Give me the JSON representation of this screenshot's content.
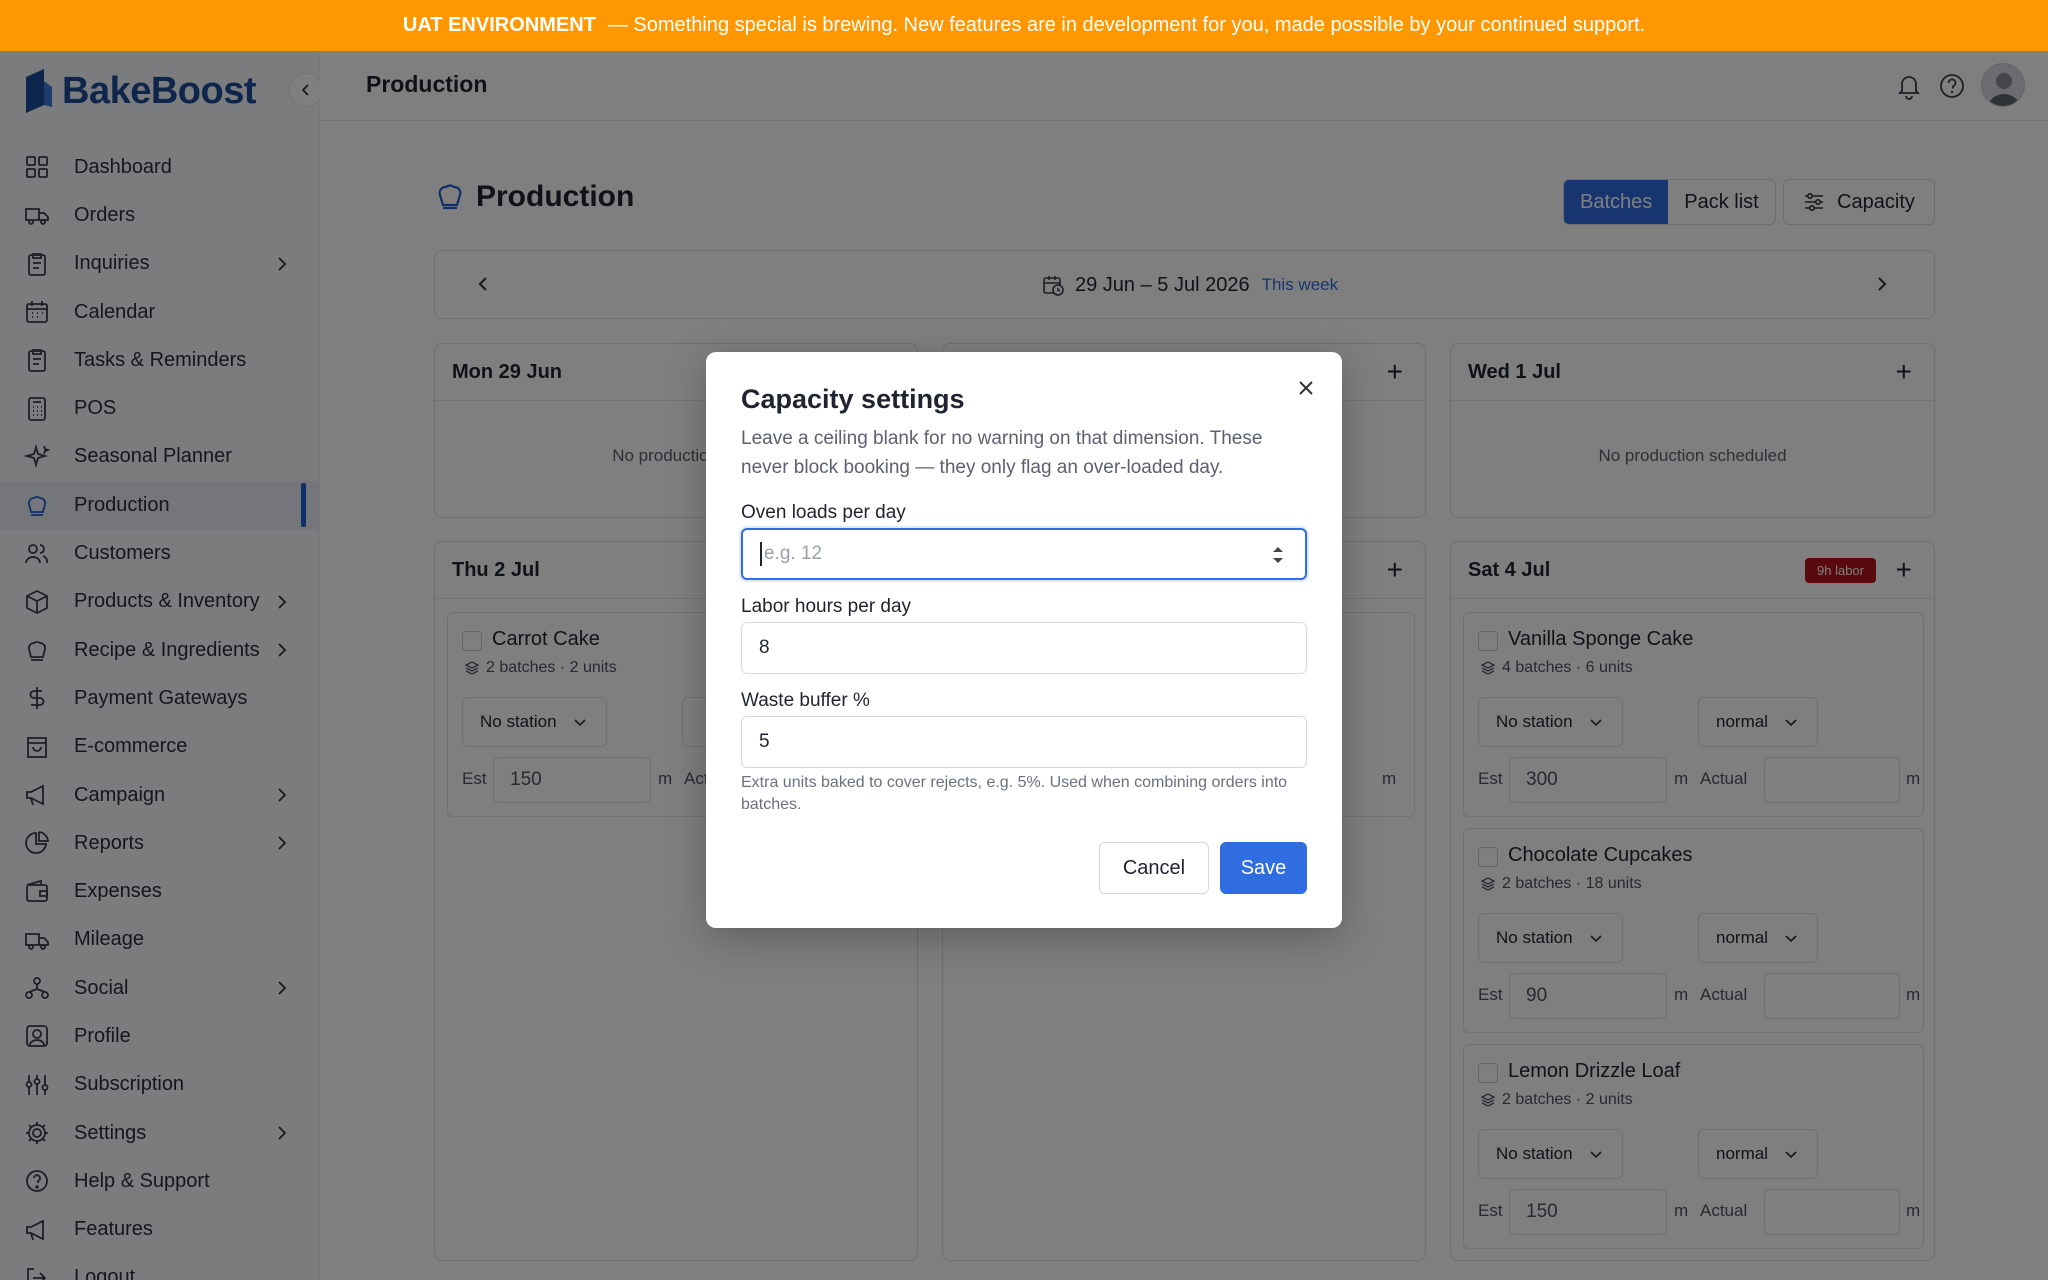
{
  "banner": {
    "env": "UAT ENVIRONMENT",
    "message": "— Something special is brewing. New features are in development for you, made possible by your continued support."
  },
  "app": {
    "name": "BakeBoost"
  },
  "sidebar": {
    "items": [
      {
        "label": "Dashboard",
        "icon": "grid-icon"
      },
      {
        "label": "Orders",
        "icon": "truck-icon"
      },
      {
        "label": "Inquiries",
        "icon": "clipboard-icon",
        "chevron": true
      },
      {
        "label": "Calendar",
        "icon": "calendar-icon"
      },
      {
        "label": "Tasks & Reminders",
        "icon": "clipboard-icon"
      },
      {
        "label": "POS",
        "icon": "calculator-icon"
      },
      {
        "label": "Seasonal Planner",
        "icon": "sparkle-icon"
      },
      {
        "label": "Production",
        "icon": "chef-hat-icon",
        "active": true
      },
      {
        "label": "Customers",
        "icon": "users-icon"
      },
      {
        "label": "Products & Inventory",
        "icon": "box-icon",
        "chevron": true
      },
      {
        "label": "Recipe & Ingredients",
        "icon": "chef-hat-icon",
        "chevron": true
      },
      {
        "label": "Payment Gateways",
        "icon": "dollar-icon"
      },
      {
        "label": "E-commerce",
        "icon": "shopping-bag-icon"
      },
      {
        "label": "Campaign",
        "icon": "megaphone-icon",
        "chevron": true
      },
      {
        "label": "Reports",
        "icon": "pie-chart-icon",
        "chevron": true
      },
      {
        "label": "Expenses",
        "icon": "wallet-icon"
      },
      {
        "label": "Mileage",
        "icon": "truck-icon"
      },
      {
        "label": "Social",
        "icon": "network-icon",
        "chevron": true
      },
      {
        "label": "Profile",
        "icon": "user-square-icon"
      },
      {
        "label": "Subscription",
        "icon": "sliders-icon"
      },
      {
        "label": "Settings",
        "icon": "gear-icon",
        "chevron": true
      },
      {
        "label": "Help & Support",
        "icon": "help-circle-icon"
      },
      {
        "label": "Features",
        "icon": "megaphone-icon"
      },
      {
        "label": "Logout",
        "icon": "logout-icon"
      }
    ]
  },
  "header": {
    "title": "Production"
  },
  "page": {
    "title": "Production",
    "tabs": [
      {
        "label": "Batches",
        "active": true
      },
      {
        "label": "Pack list"
      }
    ],
    "capacity_label": "Capacity",
    "week_range": "29 Jun – 5 Jul 2026",
    "this_week": "This week"
  },
  "days": {
    "mon": {
      "label": "Mon 29 Jun",
      "empty": "No production sc"
    },
    "wed": {
      "label": "Wed 1 Jul",
      "empty": "No production scheduled"
    },
    "thu": {
      "label": "Thu 2 Jul"
    },
    "sat": {
      "label": "Sat 4 Jul",
      "badge": "9h labor"
    }
  },
  "cards": {
    "thu0": {
      "name": "Carrot Cake",
      "sub": "2 batches · 2 units",
      "station": "No station",
      "est_label": "Est",
      "est": "150",
      "unit": "m",
      "actual_label": "Act"
    },
    "sat0": {
      "name": "Vanilla Sponge Cake",
      "sub": "4 batches · 6 units",
      "station": "No station",
      "priority": "normal",
      "est_label": "Est",
      "est": "300",
      "unit": "m",
      "actual_label": "Actual"
    },
    "sat1": {
      "name": "Chocolate Cupcakes",
      "sub": "2 batches · 18 units",
      "station": "No station",
      "priority": "normal",
      "est_label": "Est",
      "est": "90",
      "unit": "m",
      "actual_label": "Actual"
    },
    "sat2": {
      "name": "Lemon Drizzle Loaf",
      "sub": "2 batches · 2 units",
      "station": "No station",
      "priority": "normal",
      "est_label": "Est",
      "est": "150",
      "unit": "m",
      "actual_label": "Actual"
    }
  },
  "modal": {
    "title": "Capacity settings",
    "description": "Leave a ceiling blank for no warning on that dimension. These never block booking — they only flag an over-loaded day.",
    "oven_label": "Oven loads per day",
    "oven_placeholder": "e.g. 12",
    "labor_label": "Labor hours per day",
    "labor_value": "8",
    "waste_label": "Waste buffer %",
    "waste_value": "5",
    "waste_hint": "Extra units baked to cover rejects, e.g. 5%. Used when combining orders into batches.",
    "cancel": "Cancel",
    "save": "Save"
  },
  "colors": {
    "banner": "#ff9800",
    "primary": "#2f6de0",
    "brand": "#1f4c99",
    "labor_badge": "#b3131b"
  }
}
